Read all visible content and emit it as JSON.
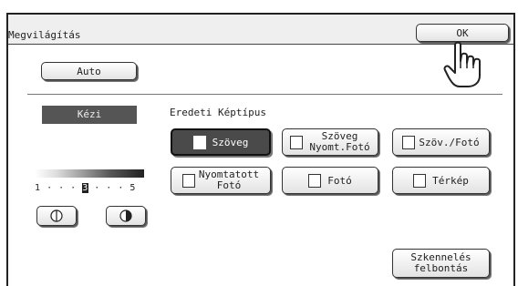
{
  "window": {
    "title": "Megvilágítás",
    "ok_label": "OK"
  },
  "auto_label": "Auto",
  "manual_label": "Kézi",
  "original_type_label": "Eredeti Képtípus",
  "types": [
    {
      "label": "Szöveg",
      "icon": "text-doc-icon"
    },
    {
      "label": "Szöveg\nNyomt.Fotó",
      "icon": "text-printed-photo-icon"
    },
    {
      "label": "Szöv./Fotó",
      "icon": "text-photo-icon"
    },
    {
      "label": "Nyomtatott\nFotó",
      "icon": "printed-photo-icon"
    },
    {
      "label": "Fotó",
      "icon": "photo-icon"
    },
    {
      "label": "Térkép",
      "icon": "map-icon"
    }
  ],
  "exposure_scale": {
    "min_label": "1",
    "dots": "· · ·",
    "current_label": "3",
    "max_label": "5",
    "current_level": 3
  },
  "resolution_button": "Szkennelés\nfelbontás",
  "icons": {
    "lighter": "lighter-half-circle-icon",
    "darker": "darker-half-circle-icon",
    "pointer": "pointing-hand-icon"
  }
}
